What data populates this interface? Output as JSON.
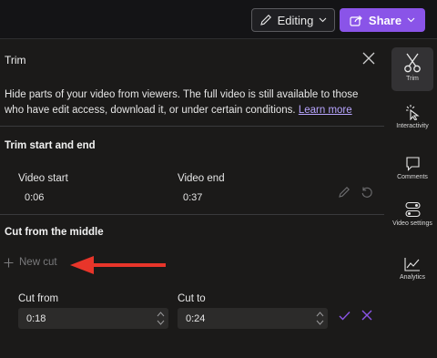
{
  "header": {
    "editing_label": "Editing",
    "share_label": "Share"
  },
  "trim_panel": {
    "title": "Trim",
    "description": "Hide parts of your video from viewers. The full video is still available to those who have edit access, download it, or under certain conditions.",
    "learn_more": "Learn more",
    "trim_section_title": "Trim start and end",
    "video_start_label": "Video start",
    "video_start_value": "0:06",
    "video_end_label": "Video end",
    "video_end_value": "0:37",
    "cut_section_title": "Cut from the middle",
    "new_cut_label": "New cut",
    "cut_from_label": "Cut from",
    "cut_from_value": "0:18",
    "cut_to_label": "Cut to",
    "cut_to_value": "0:24"
  },
  "rail": {
    "items": [
      {
        "label": "Trim",
        "icon": "scissors-icon"
      },
      {
        "label": "Interactivity",
        "icon": "interactivity-icon"
      },
      {
        "label": "Comments",
        "icon": "comment-icon"
      },
      {
        "label": "Video settings",
        "icon": "settings-toggle-icon"
      },
      {
        "label": "Analytics",
        "icon": "analytics-icon"
      }
    ]
  },
  "colors": {
    "accent": "#8a54e8",
    "link": "#b8a5ff",
    "annotation_arrow": "#e8352a"
  }
}
